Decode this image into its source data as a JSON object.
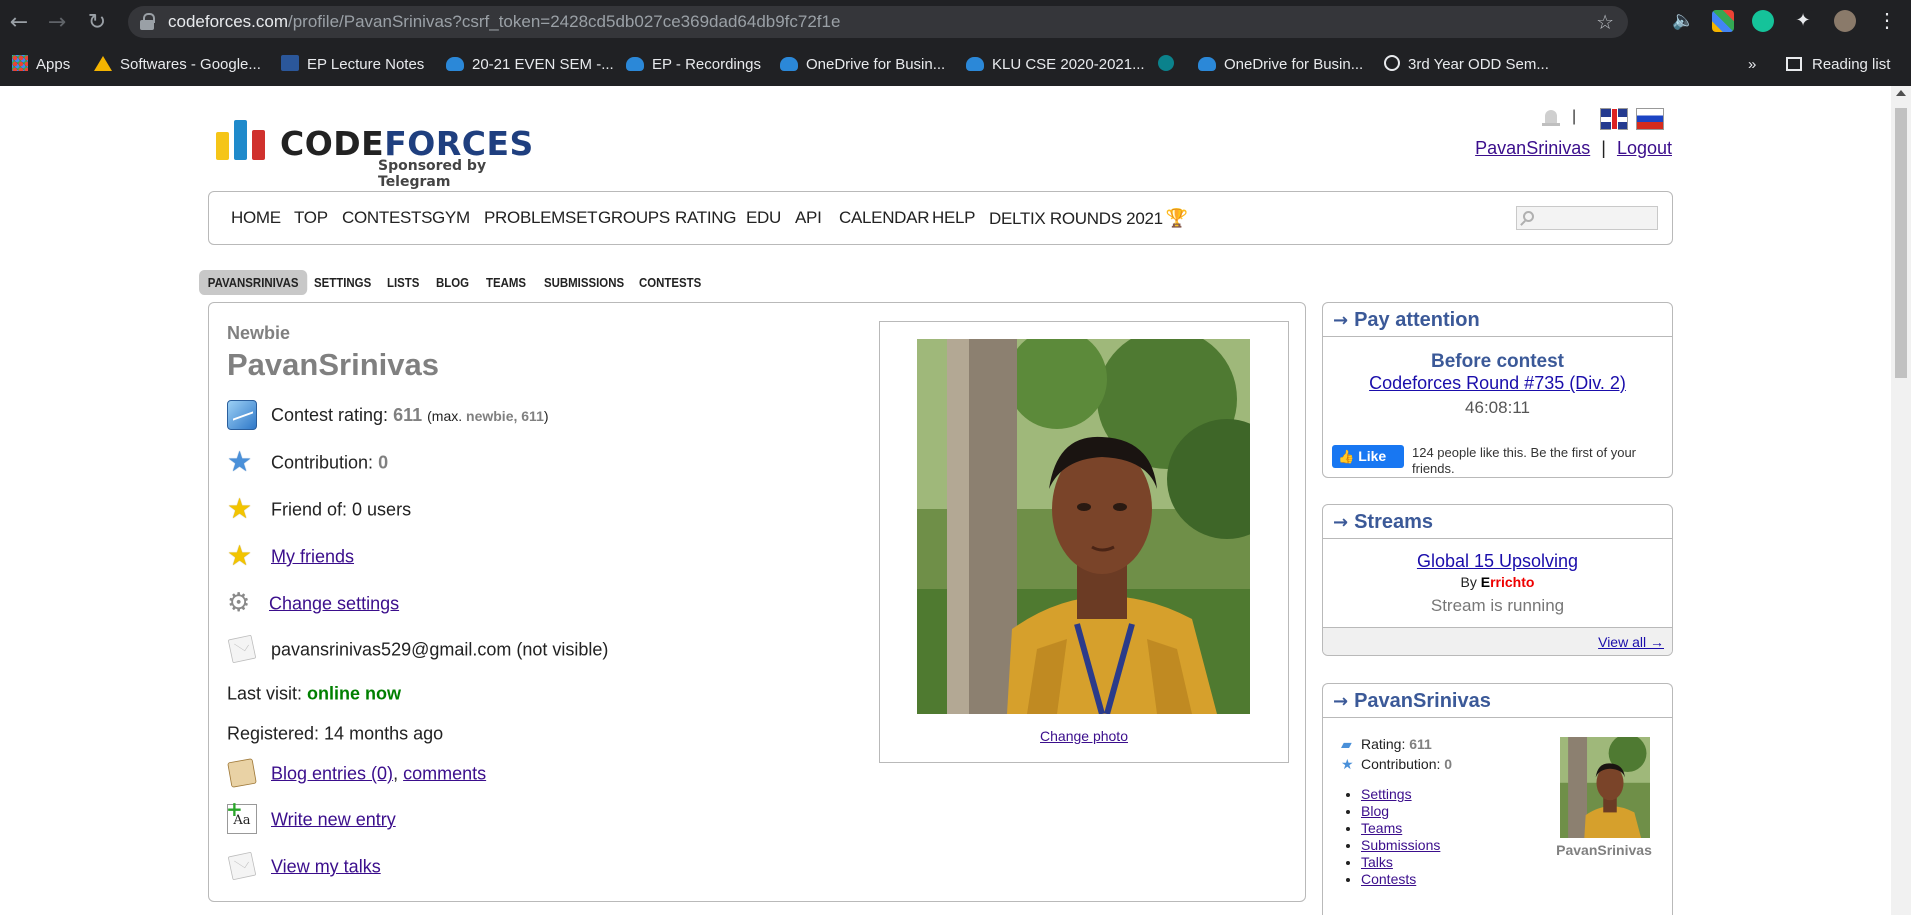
{
  "browser": {
    "url_host": "codeforces.com",
    "url_path": "/profile/PavanSrinivas?csrf_token=2428cd5db027ce369dad64db9fc72f1e",
    "bookmarks": [
      {
        "label": "Apps",
        "icon": "apps-grid-icon"
      },
      {
        "label": "Softwares - Google...",
        "icon": "google-drive-icon"
      },
      {
        "label": "EP Lecture Notes",
        "icon": "word-icon"
      },
      {
        "label": "20-21 EVEN SEM -...",
        "icon": "onedrive-icon"
      },
      {
        "label": "EP - Recordings",
        "icon": "onedrive-icon"
      },
      {
        "label": "OneDrive for Busin...",
        "icon": "onedrive-icon"
      },
      {
        "label": "KLU CSE 2020-2021...",
        "icon": "onedrive-icon"
      },
      {
        "label": "",
        "icon": "sharepoint-icon"
      },
      {
        "label": "OneDrive for Busin...",
        "icon": "onedrive-icon"
      },
      {
        "label": "3rd Year ODD Sem...",
        "icon": "globe-icon"
      }
    ],
    "more_bookmarks": "»",
    "reading_list": "Reading list"
  },
  "header": {
    "logo_code": "CODE",
    "logo_forces": "FORCES",
    "logo_sub": "Sponsored by Telegram",
    "separator": "|",
    "user_link": "PavanSrinivas",
    "logout": "Logout"
  },
  "menu": {
    "items": [
      "HOME",
      "TOP",
      "CONTESTS",
      "GYM",
      "PROBLEMSET",
      "GROUPS",
      "RATING",
      "EDU",
      "API",
      "CALENDAR",
      "HELP",
      "DELTIX ROUNDS 2021"
    ]
  },
  "subtabs": [
    "PAVANSRINIVAS",
    "SETTINGS",
    "LISTS",
    "BLOG",
    "TEAMS",
    "SUBMISSIONS",
    "CONTESTS"
  ],
  "profile": {
    "rank": "Newbie",
    "handle": "PavanSrinivas",
    "contest_rating_label": "Contest rating:",
    "contest_rating": "611",
    "max_prefix": "(max.",
    "max_rank_value": "newbie, 611",
    "max_suffix": ")",
    "contribution_label": "Contribution:",
    "contribution": "0",
    "friend_of": "Friend of: 0 users",
    "my_friends": "My friends",
    "change_settings": "Change settings",
    "email": "pavansrinivas529@gmail.com (not visible)",
    "last_visit_label": "Last visit:",
    "last_visit": "online now",
    "registered": "Registered: 14 months ago",
    "blog_entries": "Blog entries (0)",
    "comma": ",",
    "comments": "comments",
    "write_new_entry": "Write new entry",
    "view_my_talks": "View my talks",
    "change_photo": "Change photo",
    "write_icon_text": "Aa"
  },
  "sidebar": {
    "pay_attention": {
      "title": "Pay attention",
      "arrow": "→",
      "before_contest": "Before contest",
      "contest_link": "Codeforces Round #735 (Div. 2)",
      "countdown": "46:08:11",
      "fb_like": "Like",
      "fb_text": "124 people like this. Be the first of your friends."
    },
    "streams": {
      "title": "Streams",
      "arrow": "→",
      "stream_link": "Global 15 Upsolving",
      "by": "By",
      "author_first": "E",
      "author_rest": "rrichto",
      "status": "Stream is running",
      "view_all": "View all →"
    },
    "user_box": {
      "title": "PavanSrinivas",
      "arrow": "→",
      "rating_label": "Rating:",
      "rating": "611",
      "contribution_label": "Contribution:",
      "contribution": "0",
      "links": [
        "Settings",
        "Blog",
        "Teams",
        "Submissions",
        "Talks",
        "Contests"
      ],
      "name": "PavanSrinivas"
    }
  },
  "colors": {
    "newbie": "#808080",
    "online": "#008000",
    "sidebar_title": "#3b5998",
    "link": "#3b0e8c",
    "logo_dark": "#222222",
    "logo_blue": "#1f3f7f"
  }
}
